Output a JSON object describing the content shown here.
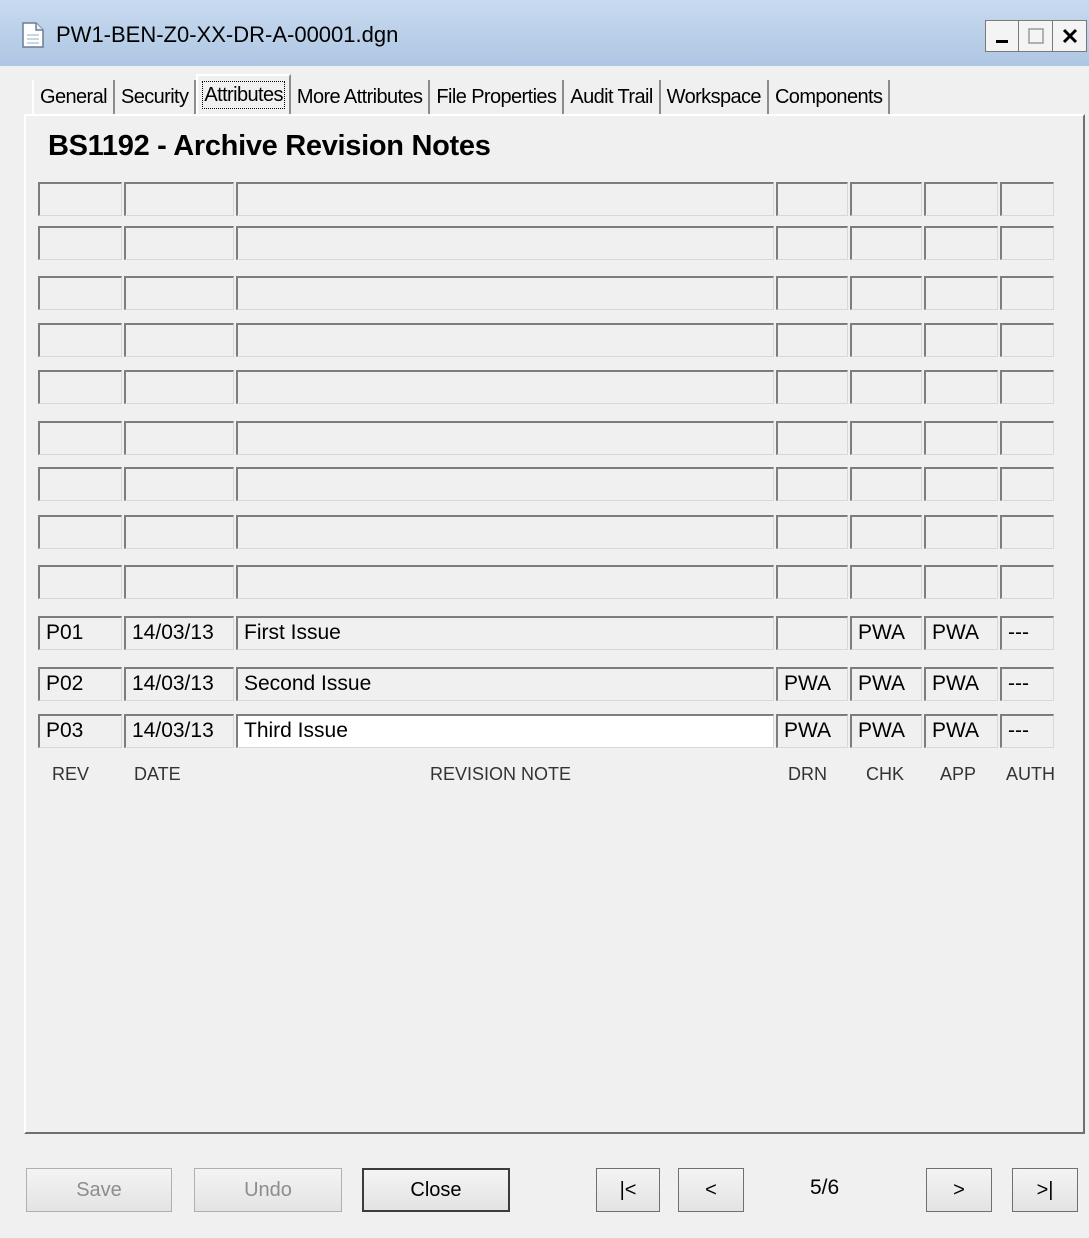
{
  "window": {
    "title": "PW1-BEN-Z0-XX-DR-A-00001.dgn",
    "controls": {
      "minimize": "_",
      "maximize": "□",
      "close": "X"
    }
  },
  "tabs": [
    {
      "label": "General"
    },
    {
      "label": "Security"
    },
    {
      "label": "Attributes",
      "active": true
    },
    {
      "label": "More Attributes"
    },
    {
      "label": "File Properties"
    },
    {
      "label": "Audit Trail"
    },
    {
      "label": "Workspace"
    },
    {
      "label": "Components"
    }
  ],
  "form": {
    "heading": "BS1192 - Archive Revision Notes",
    "column_labels": {
      "rev": "REV",
      "date": "DATE",
      "note": "REVISION NOTE",
      "drn": "DRN",
      "chk": "CHK",
      "app": "APP",
      "auth": "AUTH"
    },
    "empty_rows": 9,
    "rows": [
      {
        "rev": "P01",
        "date": "14/03/13",
        "note": "First Issue",
        "drn": "",
        "chk": "PWA",
        "app": "PWA",
        "auth": "---"
      },
      {
        "rev": "P02",
        "date": "14/03/13",
        "note": "Second Issue",
        "drn": "PWA",
        "chk": "PWA",
        "app": "PWA",
        "auth": "---"
      },
      {
        "rev": "P03",
        "date": "14/03/13",
        "note": "Third Issue",
        "drn": "PWA",
        "chk": "PWA",
        "app": "PWA",
        "auth": "---"
      }
    ]
  },
  "footer": {
    "save_label": "Save",
    "undo_label": "Undo",
    "close_label": "Close",
    "first_label": "|<",
    "prev_label": "<",
    "page_indicator": "5/6",
    "next_label": ">",
    "last_label": ">|"
  }
}
